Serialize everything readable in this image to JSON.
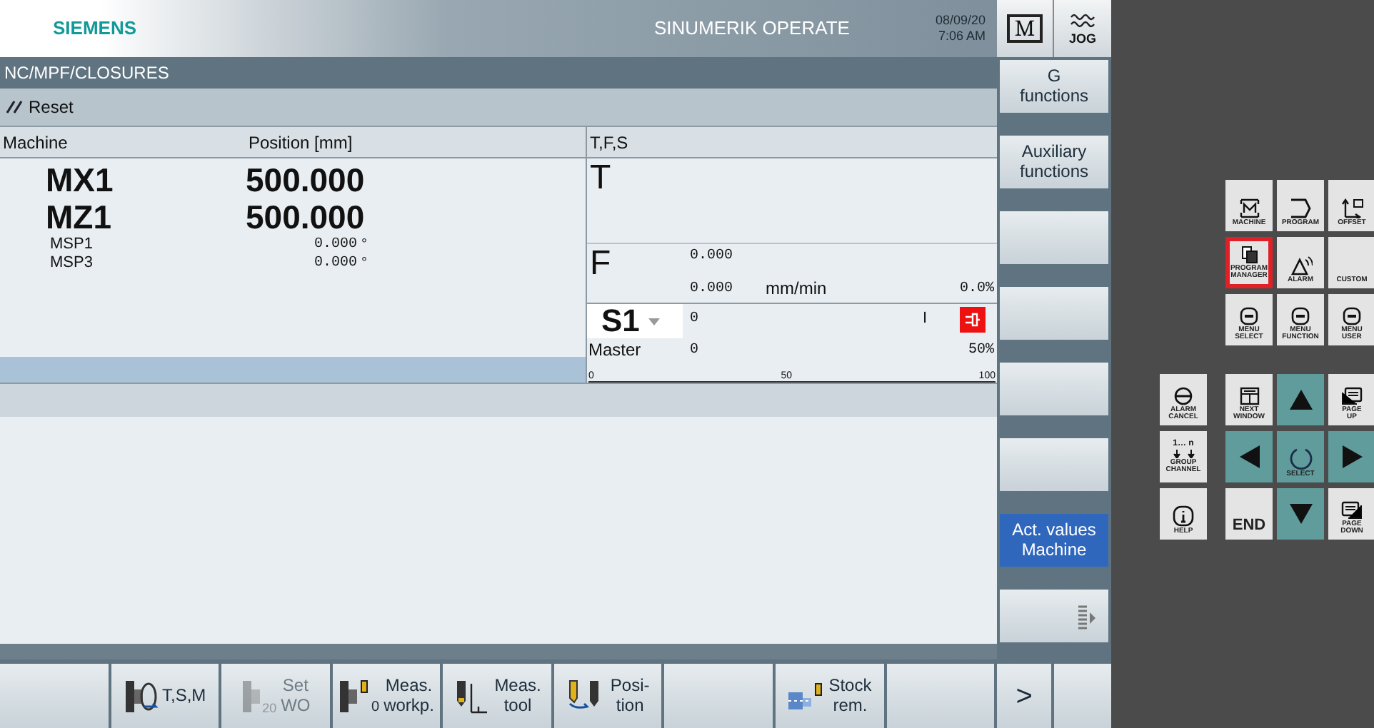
{
  "header": {
    "brand": "SIEMENS",
    "product": "SINUMERIK OPERATE",
    "date": "08/09/20",
    "time": "7:06 AM",
    "mode_letter": "M",
    "mode": "JOG"
  },
  "path": "NC/MPF/CLOSURES",
  "status": "Reset",
  "positions": {
    "columns": [
      "Machine",
      "Position [mm]"
    ],
    "rows": [
      {
        "axis": "MX1",
        "value": "500.000",
        "kind": "large"
      },
      {
        "axis": "MZ1",
        "value": "500.000",
        "kind": "large"
      },
      {
        "axis": "MSP1",
        "value": "0.000",
        "unit": "°",
        "kind": "small"
      },
      {
        "axis": "MSP3",
        "value": "0.000",
        "unit": "°",
        "kind": "small"
      }
    ]
  },
  "tfs": {
    "title": "T,F,S",
    "t_label": "T",
    "f_label": "F",
    "feed": {
      "programmed": "0.000",
      "actual": "0.000",
      "unit": "mm/min",
      "override": "0.0%"
    },
    "spindle": {
      "name": "S1",
      "mode": "Master",
      "set": "0",
      "actual": "0",
      "override": "50%",
      "marker": "I",
      "scale": [
        "0",
        "50",
        "100"
      ]
    }
  },
  "vertical_softkeys": [
    {
      "kind": "text",
      "lines": [
        "G",
        "functions"
      ],
      "selected": false
    },
    {
      "kind": "text",
      "lines": [
        "Auxiliary",
        "functions"
      ],
      "selected": false
    },
    {
      "kind": "blank",
      "selected": false
    },
    {
      "kind": "blank",
      "selected": false
    },
    {
      "kind": "blank",
      "selected": false
    },
    {
      "kind": "blank",
      "selected": false
    },
    {
      "kind": "text",
      "lines": [
        "Act. values",
        "Machine"
      ],
      "selected": true
    },
    {
      "kind": "more",
      "selected": false
    }
  ],
  "horizontal_softkeys": [
    {
      "kind": "blank"
    },
    {
      "kind": "tsm",
      "lines": [
        "T,S,M"
      ],
      "disabled": false
    },
    {
      "kind": "setwo",
      "lines": [
        "Set",
        "WO"
      ],
      "icon_text": "20",
      "disabled": true
    },
    {
      "kind": "measworkp",
      "lines": [
        "Meas.",
        "workp."
      ],
      "icon_text": "0",
      "disabled": false
    },
    {
      "kind": "meastool",
      "lines": [
        "Meas.",
        "tool"
      ],
      "disabled": false
    },
    {
      "kind": "position",
      "lines": [
        "Posi-",
        "tion"
      ],
      "disabled": false
    },
    {
      "kind": "blank"
    },
    {
      "kind": "stock",
      "lines": [
        "Stock",
        "rem."
      ],
      "disabled": false
    },
    {
      "kind": "blank"
    },
    {
      "kind": "next",
      "lines": [
        ">"
      ],
      "disabled": false
    },
    {
      "kind": "narrow"
    }
  ],
  "keypad": {
    "upper": [
      {
        "kind": "machine",
        "lines": [
          "MACHINE"
        ],
        "highlighted": false
      },
      {
        "kind": "program",
        "lines": [
          "PROGRAM"
        ],
        "highlighted": false
      },
      {
        "kind": "offset",
        "lines": [
          "OFFSET"
        ],
        "highlighted": false
      },
      {
        "kind": "progman",
        "lines": [
          "PROGRAM",
          "MANAGER"
        ],
        "highlighted": true
      },
      {
        "kind": "alarm",
        "lines": [
          "ALARM"
        ],
        "highlighted": false
      },
      {
        "kind": "plain",
        "lines": [
          "CUSTOM"
        ],
        "highlighted": false
      },
      {
        "kind": "menu",
        "lines": [
          "MENU",
          "SELECT"
        ],
        "highlighted": false
      },
      {
        "kind": "menu",
        "lines": [
          "MENU",
          "FUNCTION"
        ],
        "highlighted": false
      },
      {
        "kind": "menu",
        "lines": [
          "MENU",
          "USER"
        ],
        "highlighted": false
      }
    ],
    "lower": [
      {
        "kind": "alarmcancel",
        "lines": [
          "ALARM",
          "CANCEL"
        ],
        "highlighted": false
      },
      {
        "kind": "nextwindow",
        "lines": [
          "NEXT",
          "WINDOW"
        ],
        "highlighted": false
      },
      {
        "kind": "up",
        "highlighted": false
      },
      {
        "kind": "pageup",
        "lines": [
          "PAGE",
          "UP"
        ],
        "highlighted": false
      },
      {
        "kind": "channel",
        "symbol": "1… n",
        "lines": [
          "GROUP",
          "CHANNEL"
        ],
        "highlighted": false
      },
      {
        "kind": "left",
        "highlighted": false
      },
      {
        "kind": "select",
        "lines": [
          "SELECT"
        ],
        "highlighted": false
      },
      {
        "kind": "right",
        "highlighted": false
      },
      {
        "kind": "help",
        "lines": [
          "HELP"
        ],
        "highlighted": false
      },
      {
        "kind": "big",
        "lines": [
          "END"
        ],
        "highlighted": false
      },
      {
        "kind": "down",
        "highlighted": false
      },
      {
        "kind": "pagedown",
        "lines": [
          "PAGE",
          "DOWN"
        ],
        "highlighted": false
      }
    ]
  }
}
